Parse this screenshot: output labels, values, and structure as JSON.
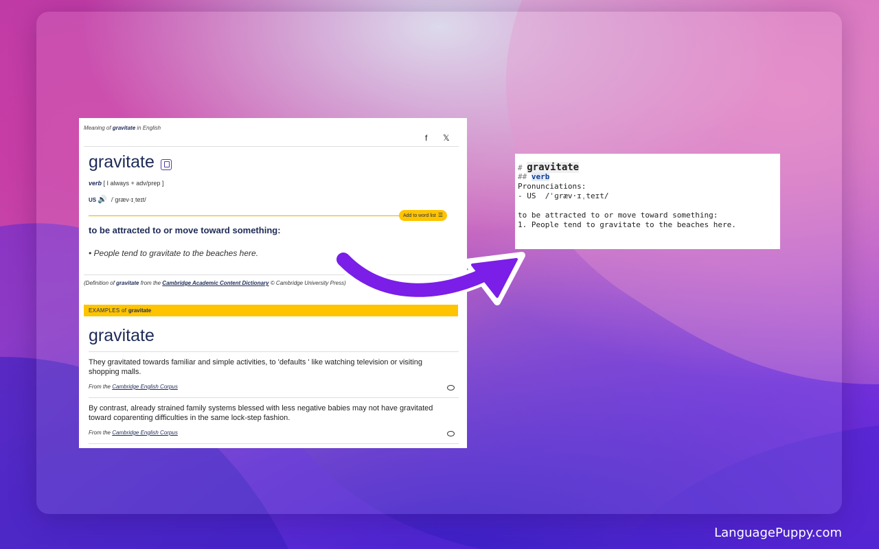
{
  "dictionary": {
    "meaning_prefix": "Meaning of ",
    "meaning_word": "gravitate",
    "meaning_suffix": " in English",
    "facebook_label": "f",
    "x_label": "𝕏",
    "headword": "gravitate",
    "pos": "verb",
    "grammar": "[ I always + adv/prep ]",
    "region": "US",
    "pronunciation": "/ˈɡræv·ɪˌteɪt/",
    "add_to_word_list": "Add to word list",
    "definition": "to be attracted to or move toward something:",
    "example": "• People tend to gravitate to the beaches here.",
    "source_prefix": "(Definition of ",
    "source_word": "gravitate",
    "source_mid": " from the ",
    "source_dict": "Cambridge Academic Content Dictionary",
    "source_suffix": " © Cambridge University Press)",
    "examples_label": "EXAMPLES of ",
    "examples_word": "gravitate",
    "examples_headword": "gravitate",
    "corpus": [
      {
        "text": "They gravitated towards familiar and simple activities, to 'defaults ' like watching television or visiting shopping malls.",
        "from": "From the ",
        "corpus_name": "Cambridge English Corpus"
      },
      {
        "text": "By contrast, already strained family systems blessed with less negative babies may not have gravitated toward coparenting difficulties in the same lock-step fashion.",
        "from": "From the ",
        "corpus_name": "Cambridge English Corpus"
      }
    ]
  },
  "markdown": {
    "line1_hash": "# ",
    "line1_word": "gravitate",
    "line2_hash": "## ",
    "line2_word": "verb",
    "line3": "Pronunciations:",
    "line4": "- US  /ˈɡræv·ɪˌteɪt/",
    "line6": "to be attracted to or move toward something:",
    "line7": "1. People tend to gravitate to the beaches here."
  },
  "brand": "LanguagePuppy.com",
  "colors": {
    "accent_yellow": "#fec400",
    "dict_navy": "#1d2a57",
    "arrow_purple": "#7a1ee8"
  }
}
